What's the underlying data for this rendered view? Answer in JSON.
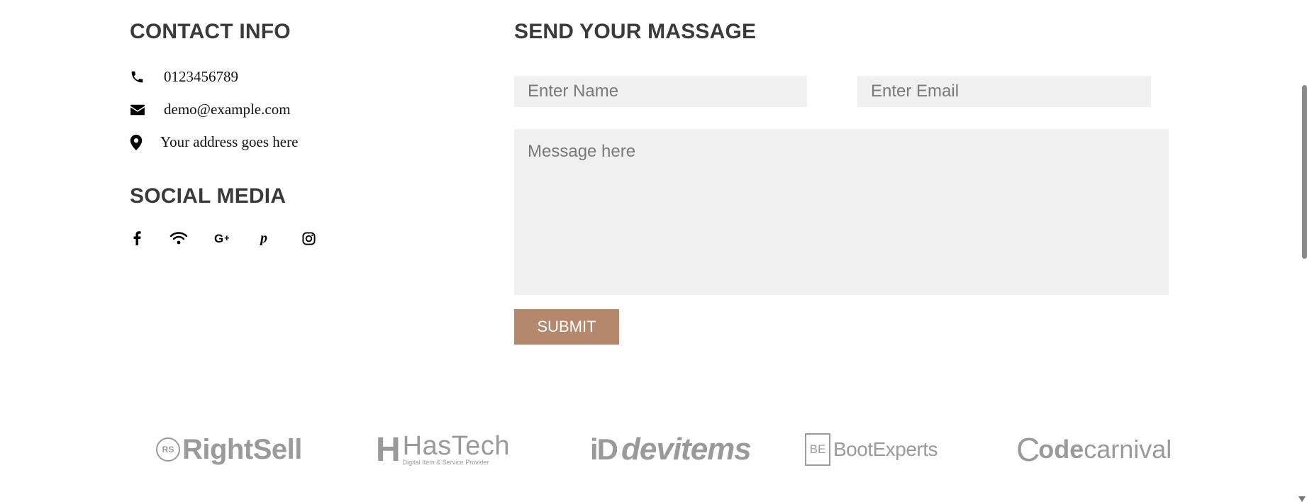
{
  "contact": {
    "heading": "CONTACT INFO",
    "phone": "0123456789",
    "email": "demo@example.com",
    "address": "Your address goes here"
  },
  "social": {
    "heading": "SOCIAL MEDIA",
    "icons": [
      "facebook-icon",
      "wifi-icon",
      "google-plus-icon",
      "pinterest-icon",
      "instagram-icon"
    ]
  },
  "form": {
    "heading": "SEND YOUR MASSAGE",
    "name_placeholder": "Enter Name",
    "email_placeholder": "Enter Email",
    "message_placeholder": "Message here",
    "submit_label": "SUBMIT"
  },
  "brands": {
    "rightsell": {
      "mark": "RS",
      "name": "RightSell"
    },
    "hastech": {
      "mark": "H",
      "name": "HasTech",
      "tagline": "Digital Item & Service Provider"
    },
    "devitems": {
      "mark": "iD",
      "name": "devitems"
    },
    "bootexperts": {
      "mark": "BE",
      "name": "BootExperts"
    },
    "codecarnival": {
      "mark": "C",
      "name_bold": "ode",
      "name_light": "carnival"
    }
  },
  "colors": {
    "accent": "#b5886d",
    "field_bg": "#f0f0f0",
    "heading": "#3a3a3a",
    "brand_gray": "#9a9a9a"
  }
}
